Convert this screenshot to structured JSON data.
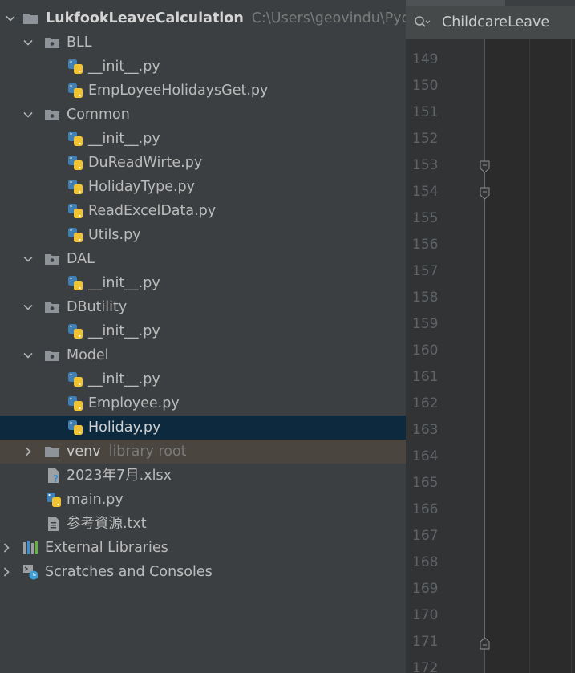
{
  "project": {
    "name": "LukfookLeaveCalculation",
    "path": "C:\\Users\\geovindu\\Pycha"
  },
  "tree": {
    "bll": {
      "label": "BLL"
    },
    "bll_init": {
      "label": "__init__.py"
    },
    "bll_emp": {
      "label": "EmpLoyeeHolidaysGet.py"
    },
    "common": {
      "label": "Common"
    },
    "common_init": {
      "label": "__init__.py"
    },
    "common_du": {
      "label": "DuReadWirte.py"
    },
    "common_holidaytype": {
      "label": "HolidayType.py"
    },
    "common_readexcel": {
      "label": "ReadExcelData.py"
    },
    "common_utils": {
      "label": "Utils.py"
    },
    "dal": {
      "label": "DAL"
    },
    "dal_init": {
      "label": "__init__.py"
    },
    "dbutility": {
      "label": "DButility"
    },
    "dbutility_init": {
      "label": "__init__.py"
    },
    "model": {
      "label": "Model"
    },
    "model_init": {
      "label": "__init__.py"
    },
    "model_employee": {
      "label": "Employee.py"
    },
    "model_holiday": {
      "label": "Holiday.py"
    },
    "venv": {
      "label": "venv",
      "hint": "library root"
    },
    "xlsx": {
      "label": "2023年7月.xlsx"
    },
    "main": {
      "label": "main.py"
    },
    "txt": {
      "label": "参考資源.txt"
    },
    "external": {
      "label": "External Libraries"
    },
    "scratches": {
      "label": "Scratches and Consoles"
    }
  },
  "search": {
    "text": "ChildcareLeave"
  },
  "gutter": {
    "lines": [
      "149",
      "150",
      "151",
      "152",
      "153",
      "154",
      "155",
      "156",
      "157",
      "158",
      "159",
      "160",
      "161",
      "162",
      "163",
      "164",
      "165",
      "166",
      "167",
      "168",
      "169",
      "170",
      "171",
      "172"
    ]
  },
  "colors": {
    "panel_bg": "#3c3f41",
    "editor_bg": "#2b2b2b",
    "selection": "#0d293e",
    "text": "#bbbbbb"
  }
}
